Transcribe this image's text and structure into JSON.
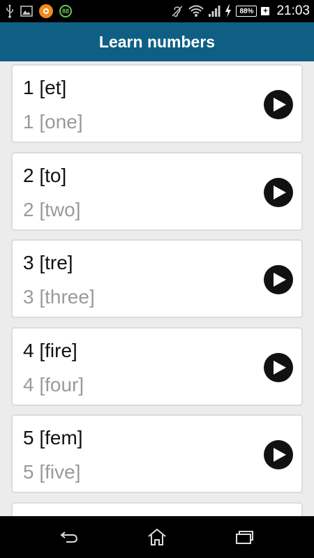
{
  "status_bar": {
    "time": "21:03",
    "battery_percent": "88%",
    "notification_badge": "88",
    "icons": [
      "usb-icon",
      "image-icon",
      "orange-app-icon",
      "badge-88-icon",
      "hearing-icon",
      "wifi-icon",
      "signal-icon",
      "charging-icon",
      "battery-icon",
      "battery-plus-icon"
    ]
  },
  "app_bar": {
    "title": "Learn numbers"
  },
  "numbers": [
    {
      "word": "1 [et]",
      "translation": "1 [one]"
    },
    {
      "word": "2 [to]",
      "translation": "2 [two]"
    },
    {
      "word": "3 [tre]",
      "translation": "3 [three]"
    },
    {
      "word": "4 [fire]",
      "translation": "4 [four]"
    },
    {
      "word": "5 [fem]",
      "translation": "5 [five]"
    },
    {
      "word": "",
      "translation": ""
    }
  ],
  "nav_bar": {
    "icons": [
      "back-icon",
      "home-icon",
      "recent-apps-icon"
    ]
  },
  "colors": {
    "app_bar": "#0f5f85",
    "background": "#ececec",
    "card_border": "#dcdcdc",
    "translation_text": "#9a9a9a"
  }
}
